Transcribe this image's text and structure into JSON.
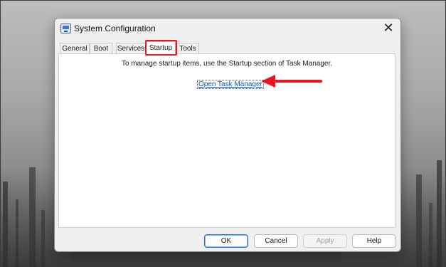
{
  "dialog": {
    "title": "System Configuration",
    "close_glyph": "✕"
  },
  "tabs": [
    {
      "label": "General"
    },
    {
      "label": "Boot"
    },
    {
      "label": "Services"
    },
    {
      "label": "Startup"
    },
    {
      "label": "Tools"
    }
  ],
  "startup": {
    "message": "To manage startup items, use the Startup section of Task Manager.",
    "link_label": "Open Task Manager"
  },
  "buttons": {
    "ok": "OK",
    "cancel": "Cancel",
    "apply": "Apply",
    "help": "Help"
  },
  "annotations": {
    "highlight_color": "#e8161e",
    "arrow_color": "#e8161e"
  },
  "icons": [
    "system-configuration-icon",
    "close-icon",
    "arrow-icon"
  ]
}
